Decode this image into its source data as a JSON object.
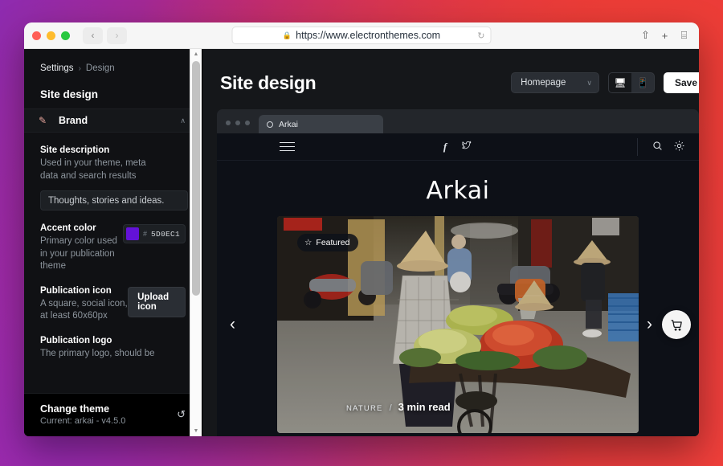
{
  "browser": {
    "url": "https://www.electronthemes.com",
    "lock_icon": "lock-icon",
    "back_icon": "‹",
    "forward_icon": "›",
    "reload_icon": "↻",
    "share_icon": "⇧",
    "newtab_icon": "+",
    "tabs_icon": "⌸"
  },
  "sidebar": {
    "breadcrumb": {
      "parent": "Settings",
      "separator": "›",
      "current": "Design"
    },
    "title": "Site design",
    "brand": {
      "label": "Brand",
      "icon": "edit-square-icon",
      "chevron": "∧"
    },
    "fields": [
      {
        "label": "Site description",
        "description": "Used in your theme, meta data and search results",
        "value": "Thoughts, stories and ideas."
      },
      {
        "label": "Accent color",
        "description": "Primary color used in your publication theme",
        "hash": "#",
        "hex": "5D0EC1",
        "swatch": "#6312d8"
      },
      {
        "label": "Publication icon",
        "description": "A square, social icon, at least 60x60px",
        "button": "Upload icon"
      },
      {
        "label": "Publication logo",
        "description": "The primary logo, should be"
      }
    ],
    "change_theme": {
      "title": "Change theme",
      "subtitle": "Current: arkai - v4.5.0",
      "icon": "refresh-icon"
    },
    "scrollbar": {
      "up": "▲",
      "down": "▼"
    }
  },
  "main": {
    "page_title": "Site design",
    "page_select": {
      "value": "Homepage",
      "chevron": "∨"
    },
    "device_toggle": {
      "desktop_icon": "▭",
      "mobile_icon": "▯",
      "active": "desktop"
    },
    "save_button": "Save"
  },
  "preview": {
    "tab_label": "Arkai",
    "tab_icon": "circle-icon",
    "nav": {
      "menu_icon": "hamburger-icon",
      "facebook_icon": "f",
      "twitter_icon": "twitter-icon",
      "search_icon": "⚲",
      "theme_icon": "sun-icon"
    },
    "site_title": "Arkai",
    "card": {
      "featured_badge": "Featured",
      "featured_star": "☆",
      "category": "NATURE",
      "separator": "/",
      "read_time": "3 min read"
    },
    "arrow_left": "‹",
    "arrow_right": "›",
    "cart_icon": "cart-icon"
  },
  "colors": {
    "accent": "#5D0EC1",
    "app_bg": "#15171a",
    "sidebar_bg": "#101114"
  }
}
